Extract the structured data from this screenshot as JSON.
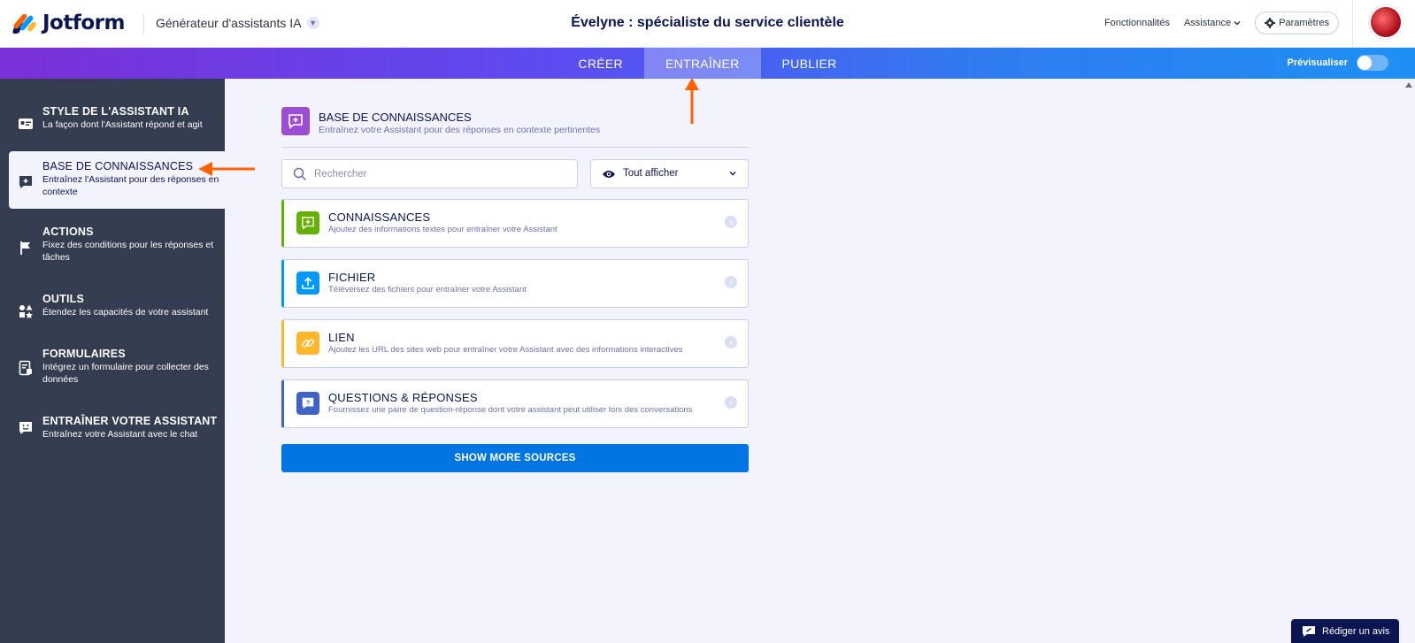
{
  "header": {
    "logo_text": "Jotform",
    "app_switch_label": "Générateur d'assistants IA",
    "page_title": "Évelyne : spécialiste du service clientèle",
    "links": {
      "features": "Fonctionnalités",
      "support": "Assistance",
      "settings": "Paramètres"
    }
  },
  "tabs": {
    "items": [
      {
        "label": "CRÉER",
        "active": false
      },
      {
        "label": "ENTRAÎNER",
        "active": true
      },
      {
        "label": "PUBLIER",
        "active": false
      }
    ],
    "preview_label": "Prévisualiser",
    "preview_enabled": false
  },
  "sidebar": {
    "items": [
      {
        "title": "STYLE DE L'ASSISTANT IA",
        "desc": "La façon dont l'Assistant répond et agit",
        "icon": "id-card-icon",
        "active": false
      },
      {
        "title": "BASE DE CONNAISSANCES",
        "desc": "Entraînez l'Assistant pour des réponses en contexte",
        "icon": "chat-plus-icon",
        "active": true
      },
      {
        "title": "ACTIONS",
        "desc": "Fixez des conditions pour les réponses et tâches",
        "icon": "flag-icon",
        "active": false
      },
      {
        "title": "OUTILS",
        "desc": "Étendez les capacités de votre assistant",
        "icon": "shapes-icon",
        "active": false
      },
      {
        "title": "FORMULAIRES",
        "desc": "Intégrez un formulaire pour collecter des données",
        "icon": "form-icon",
        "active": false
      },
      {
        "title": "ENTRAÎNER VOTRE ASSISTANT",
        "desc": "Entraînez votre Assistant avec le chat",
        "icon": "chat-smile-icon",
        "active": false
      }
    ]
  },
  "main": {
    "section_title": "BASE DE CONNAISSANCES",
    "section_subtitle": "Entraînez votre Assistant pour des réponses en contexte pertinentes",
    "search_placeholder": "Rechercher",
    "search_value": "",
    "filter_label": "Tout afficher",
    "sources": [
      {
        "title": "CONNAISSANCES",
        "desc": "Ajoutez des informations textes pour entraîner votre Assistant",
        "icon": "chat-plus-icon",
        "color": "#64b200"
      },
      {
        "title": "FICHIER",
        "desc": "Téléversez des fichiers pour entraîner votre Assistant",
        "icon": "upload-icon",
        "color": "#0099ff"
      },
      {
        "title": "LIEN",
        "desc": "Ajoutez les URL des sites web pour entraîner votre Assistant avec des informations interactives",
        "icon": "link-icon",
        "color": "#ffb629"
      },
      {
        "title": "QUESTIONS & RÉPONSES",
        "desc": "Fournissez une paire de question-réponse dont votre assistant peut utiliser lors des conversations",
        "icon": "question-chat-icon",
        "color": "#3e62c8"
      }
    ],
    "more_button": "SHOW MORE SOURCES"
  },
  "review_button": "Rédiger un avis",
  "colors": {
    "accent": "#0075e3",
    "sidebar_bg": "#343c4f",
    "annotation_arrow": "#ff6100"
  }
}
